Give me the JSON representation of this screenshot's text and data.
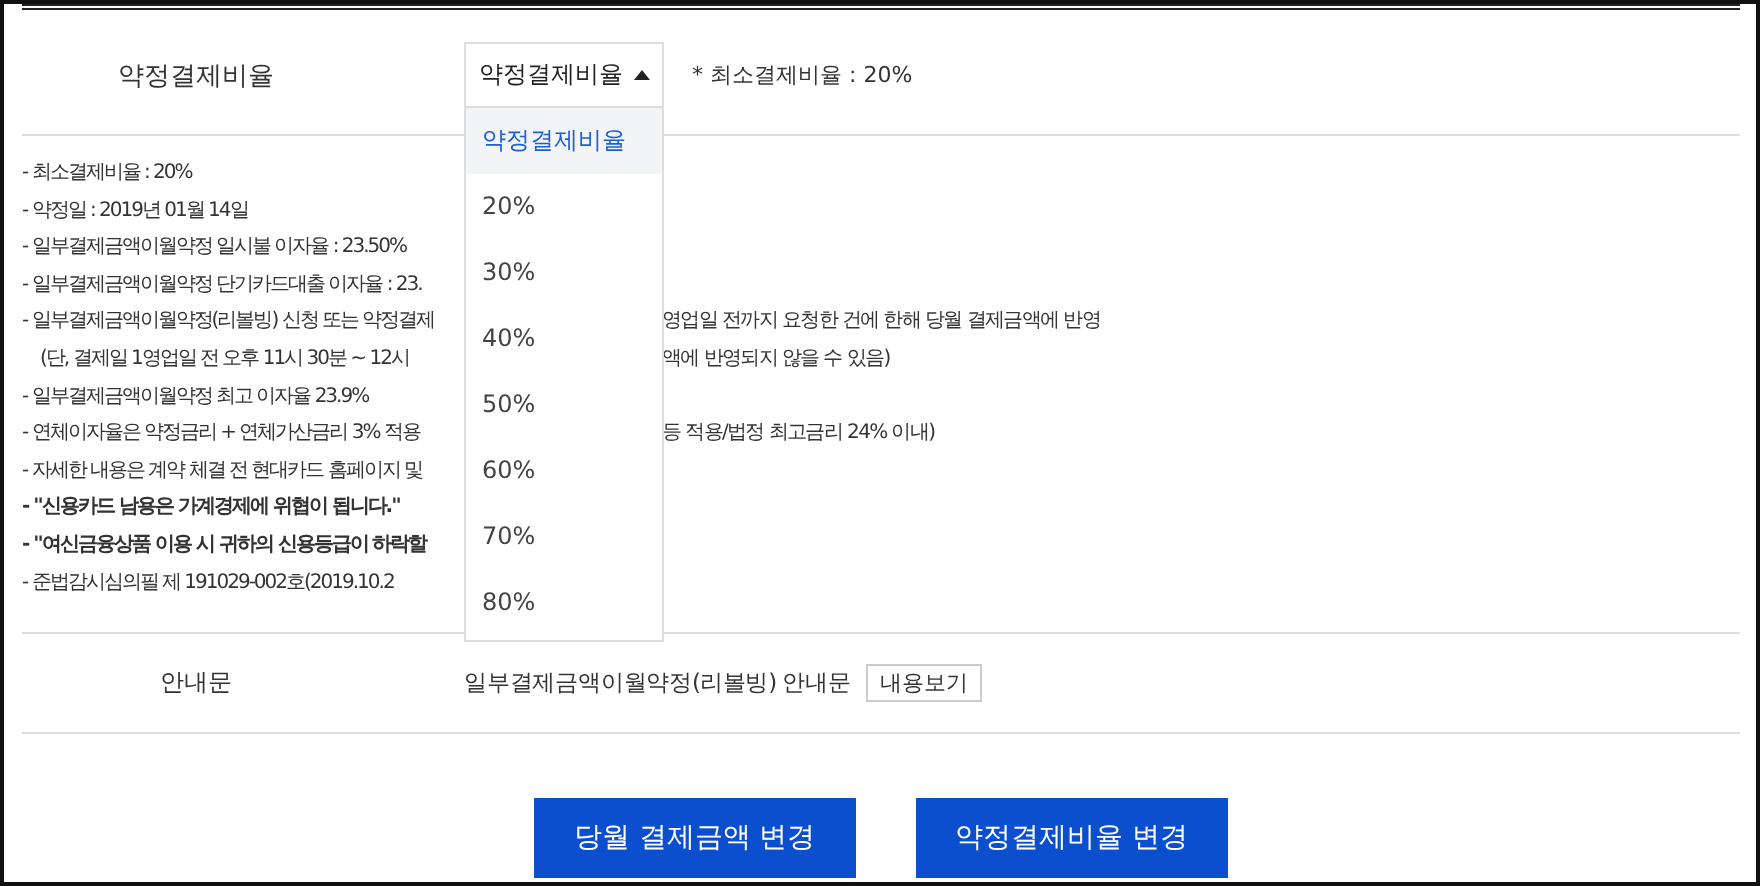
{
  "ratio_row": {
    "label": "약정결제비율",
    "dropdown": {
      "value": "약정결제비율",
      "expanded": true,
      "options": [
        {
          "label": "약정결제비율",
          "selected": true
        },
        {
          "label": "20%",
          "selected": false
        },
        {
          "label": "30%",
          "selected": false
        },
        {
          "label": "40%",
          "selected": false
        },
        {
          "label": "50%",
          "selected": false
        },
        {
          "label": "60%",
          "selected": false
        },
        {
          "label": "70%",
          "selected": false
        },
        {
          "label": "80%",
          "selected": false
        }
      ]
    },
    "hint": "* 최소결제비율 : 20%"
  },
  "notes": [
    {
      "text": "- 최소결제비율 : 20%",
      "bold": false
    },
    {
      "text": "- 약정일 : 2019년 01월 14일",
      "bold": false
    },
    {
      "text": "- 일부결제금액이월약정 일시불 이자율 : 23.50%",
      "bold": false
    },
    {
      "text": "- 일부결제금액이월약정 단기카드대출 이자율 : 23.",
      "bold": false
    },
    {
      "text": "- 일부결제금액이월약정(리볼빙) 신청 또는 약정결제",
      "bold": false,
      "right": "영업일 전까지 요청한 건에 한해 당월 결제금액에 반영"
    },
    {
      "text": "(단, 결제일 1영업일 전 오후 11시 30분 ~ 12시",
      "bold": false,
      "indent": true,
      "right": "액에 반영되지 않을 수 있음)"
    },
    {
      "text": "- 일부결제금액이월약정 최고 이자율 23.9%",
      "bold": false
    },
    {
      "text": "- 연체이자율은 약정금리 + 연체가산금리 3% 적용",
      "bold": false,
      "right": "등 적용/법정 최고금리 24% 이내)"
    },
    {
      "text": "- 자세한 내용은 계약 체결 전 현대카드 홈페이지 및",
      "bold": false
    },
    {
      "text": "- \"신용카드 남용은 가계경제에 위협이 됩니다.\"",
      "bold": true
    },
    {
      "text": "- \"여신금융상품 이용 시 귀하의 신용등급이 하락할",
      "bold": true
    },
    {
      "text": "- 준법감시심의필 제 191029-002호(2019.10.2",
      "bold": false
    }
  ],
  "guide_row": {
    "label": "안내문",
    "text": "일부결제금액이월약정(리볼빙) 안내문",
    "button": "내용보기"
  },
  "buttons": [
    "당월 결제금액 변경",
    "약정결제비율 변경"
  ]
}
